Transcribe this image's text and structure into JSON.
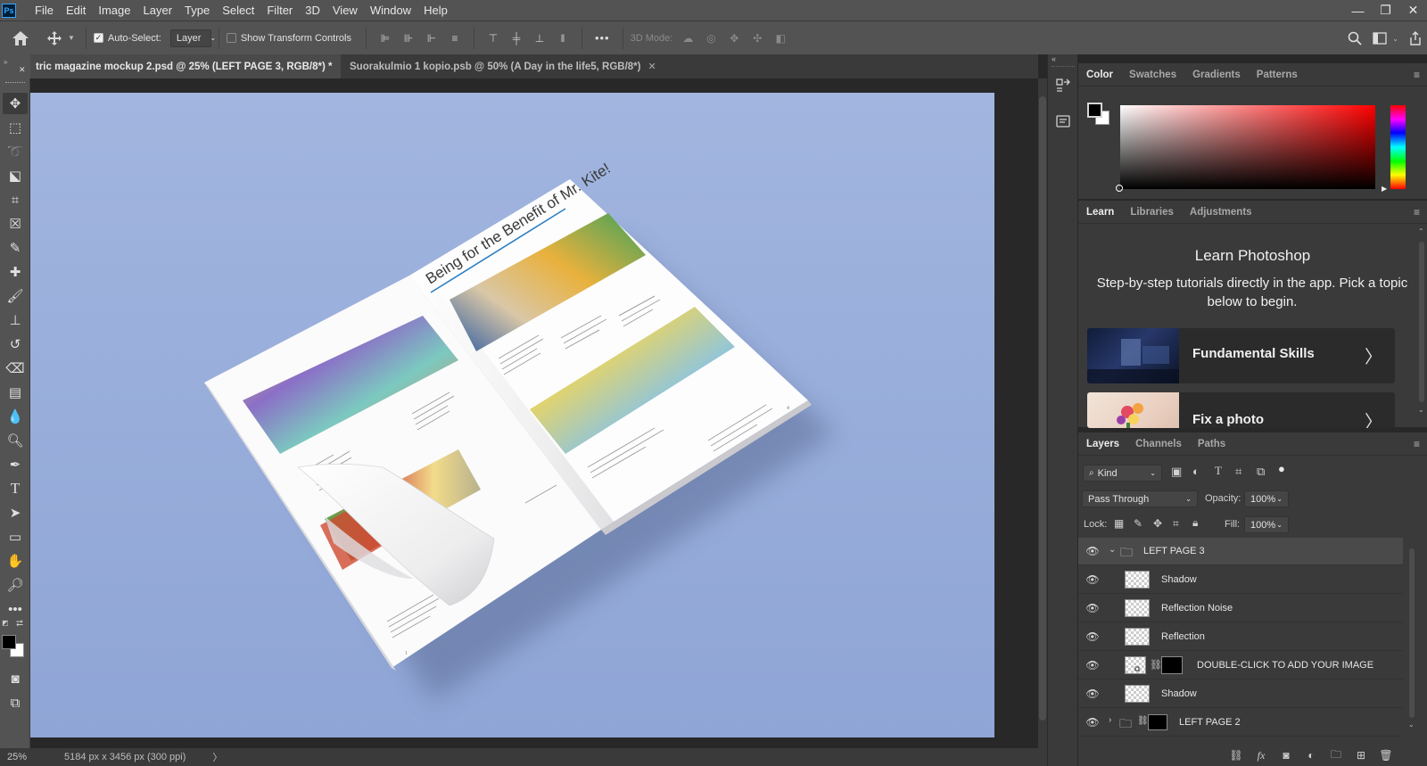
{
  "app": {
    "logo": "Ps"
  },
  "menu": [
    "File",
    "Edit",
    "Image",
    "Layer",
    "Type",
    "Select",
    "Filter",
    "3D",
    "View",
    "Window",
    "Help"
  ],
  "window_controls": {
    "minimize": "—",
    "restore": "❐",
    "close": "✕"
  },
  "options": {
    "auto_select_label": "Auto-Select:",
    "auto_select_checked": true,
    "auto_select_target": "Layer",
    "transform_label": "Show Transform Controls",
    "transform_checked": false,
    "more": "•••",
    "mode_3d_label": "3D Mode:"
  },
  "doc_tabs": [
    {
      "title": "tric magazine mockup 2.psd @ 25% (LEFT PAGE 3, RGB/8*) *",
      "active": true,
      "close": "✕"
    },
    {
      "title": "Suorakulmio 1 kopio.psb @ 50% (A Day in the life5, RGB/8*)",
      "active": false,
      "close": "✕"
    }
  ],
  "canvas": {
    "background_color": "#9bb0dc",
    "magazine_heading": "Being for the Benefit of Mr. Kite!",
    "left_page_text_1": "Woke up, fell out of bed\nDragged a comb across my head\nFound my way downstairs\nand drank a cup\nAnd looking up\nI noticed I was late",
    "left_page_text_2": "Found my coat and grabbed\nmy hat\nMade the bus in seconds flat\nFound my way upstairs\nand had a smoke\nAnd somebody spoke",
    "left_page_text_3": "It's wonderful to be here\nIt's certainly a thrill\nYou're such a lovely audience\nWe'd like to take you home with us\nWe'd love to take you home",
    "right_page_text_1": "For the benefit of Mr. Kite\nThere will be a show\ntonight on trampoline\nThe Hendersons\nwill all be there\nLate of Pablo Fanque's Fair\nWhat a scene",
    "right_page_text_2": "The band begins at ten to six\nWhen Mr. K. performs his tricks without a sound\nAnd Mr. H. will demonstrate\nTen somersets he'll undertake on solid ground",
    "right_page_text_3": "Having been some days in preparation\nA splendid time is guaranteed for all\nAnd tonight Mr. Kite is topping the bill",
    "right_page_footer": "I'd love to turn you on...",
    "page_num_left": "1",
    "page_num_right": "4"
  },
  "status": {
    "zoom": "25%",
    "doc_info": "5184 px x 3456 px (300 ppi)",
    "arrow": "〉"
  },
  "color_panel": {
    "tabs": [
      "Color",
      "Swatches",
      "Gradients",
      "Patterns"
    ],
    "active_tab": "Color",
    "foreground": "#000000",
    "background": "#ffffff",
    "hue_color": "#ff0000"
  },
  "learn_panel": {
    "tabs": [
      "Learn",
      "Libraries",
      "Adjustments"
    ],
    "active_tab": "Learn",
    "title": "Learn Photoshop",
    "description": "Step-by-step tutorials directly in the app. Pick a topic below to begin.",
    "cards": [
      {
        "label": "Fundamental Skills"
      },
      {
        "label": "Fix a photo"
      }
    ]
  },
  "layers_panel": {
    "tabs": [
      "Layers",
      "Channels",
      "Paths"
    ],
    "active_tab": "Layers",
    "filter_kind": "Kind",
    "blend_mode": "Pass Through",
    "opacity_label": "Opacity:",
    "opacity": "100%",
    "lock_label": "Lock:",
    "fill_label": "Fill:",
    "fill": "100%",
    "layers": [
      {
        "name": "LEFT PAGE 3",
        "type": "group",
        "expanded": true,
        "selected": true
      },
      {
        "name": "Shadow",
        "type": "layer"
      },
      {
        "name": "Reflection Noise",
        "type": "layer"
      },
      {
        "name": "Reflection",
        "type": "layer"
      },
      {
        "name": "DOUBLE-CLICK TO ADD YOUR IMAGE",
        "type": "smart"
      },
      {
        "name": "Shadow",
        "type": "layer"
      },
      {
        "name": "LEFT PAGE 2",
        "type": "group",
        "expanded": false
      }
    ],
    "footer_fx": "fx"
  }
}
